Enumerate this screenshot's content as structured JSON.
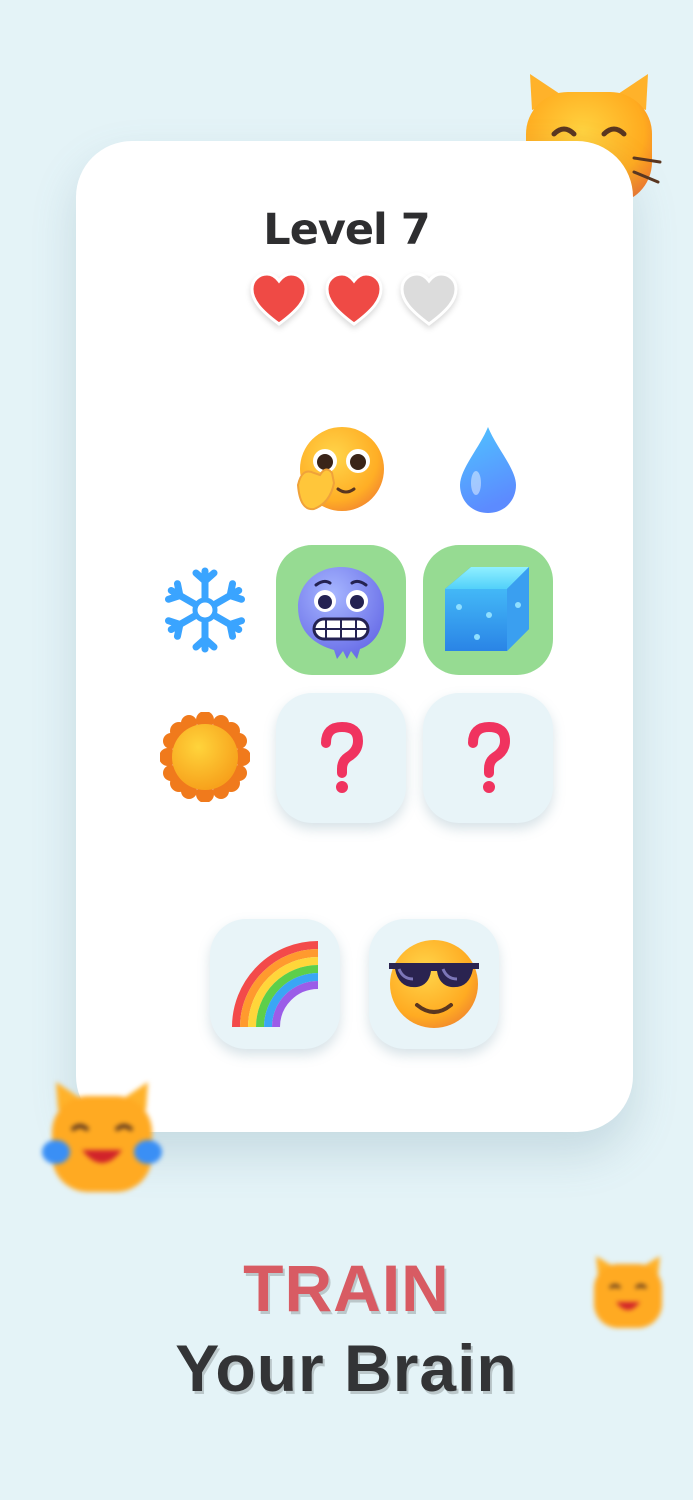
{
  "game": {
    "level_label": "Level 7",
    "lives": {
      "total": 3,
      "remaining": 2
    },
    "colors": {
      "heart_full": "#ef4a45",
      "heart_empty": "#dcdcdc",
      "correct_tile": "#96db92"
    }
  },
  "grid": {
    "column_headers": [
      "hand-over-mouth-face",
      "water-droplet"
    ],
    "row_headers": [
      "snowflake",
      "sun"
    ],
    "cells": [
      [
        "cold-face",
        "ice-cube"
      ],
      [
        "?",
        "?"
      ]
    ]
  },
  "choices": [
    "rainbow",
    "smiling-face-with-sunglasses"
  ],
  "tagline": {
    "line1": "TRAIN",
    "line2": "Your Brain",
    "line1_color": "#d85b63",
    "line2_color": "#333436"
  }
}
